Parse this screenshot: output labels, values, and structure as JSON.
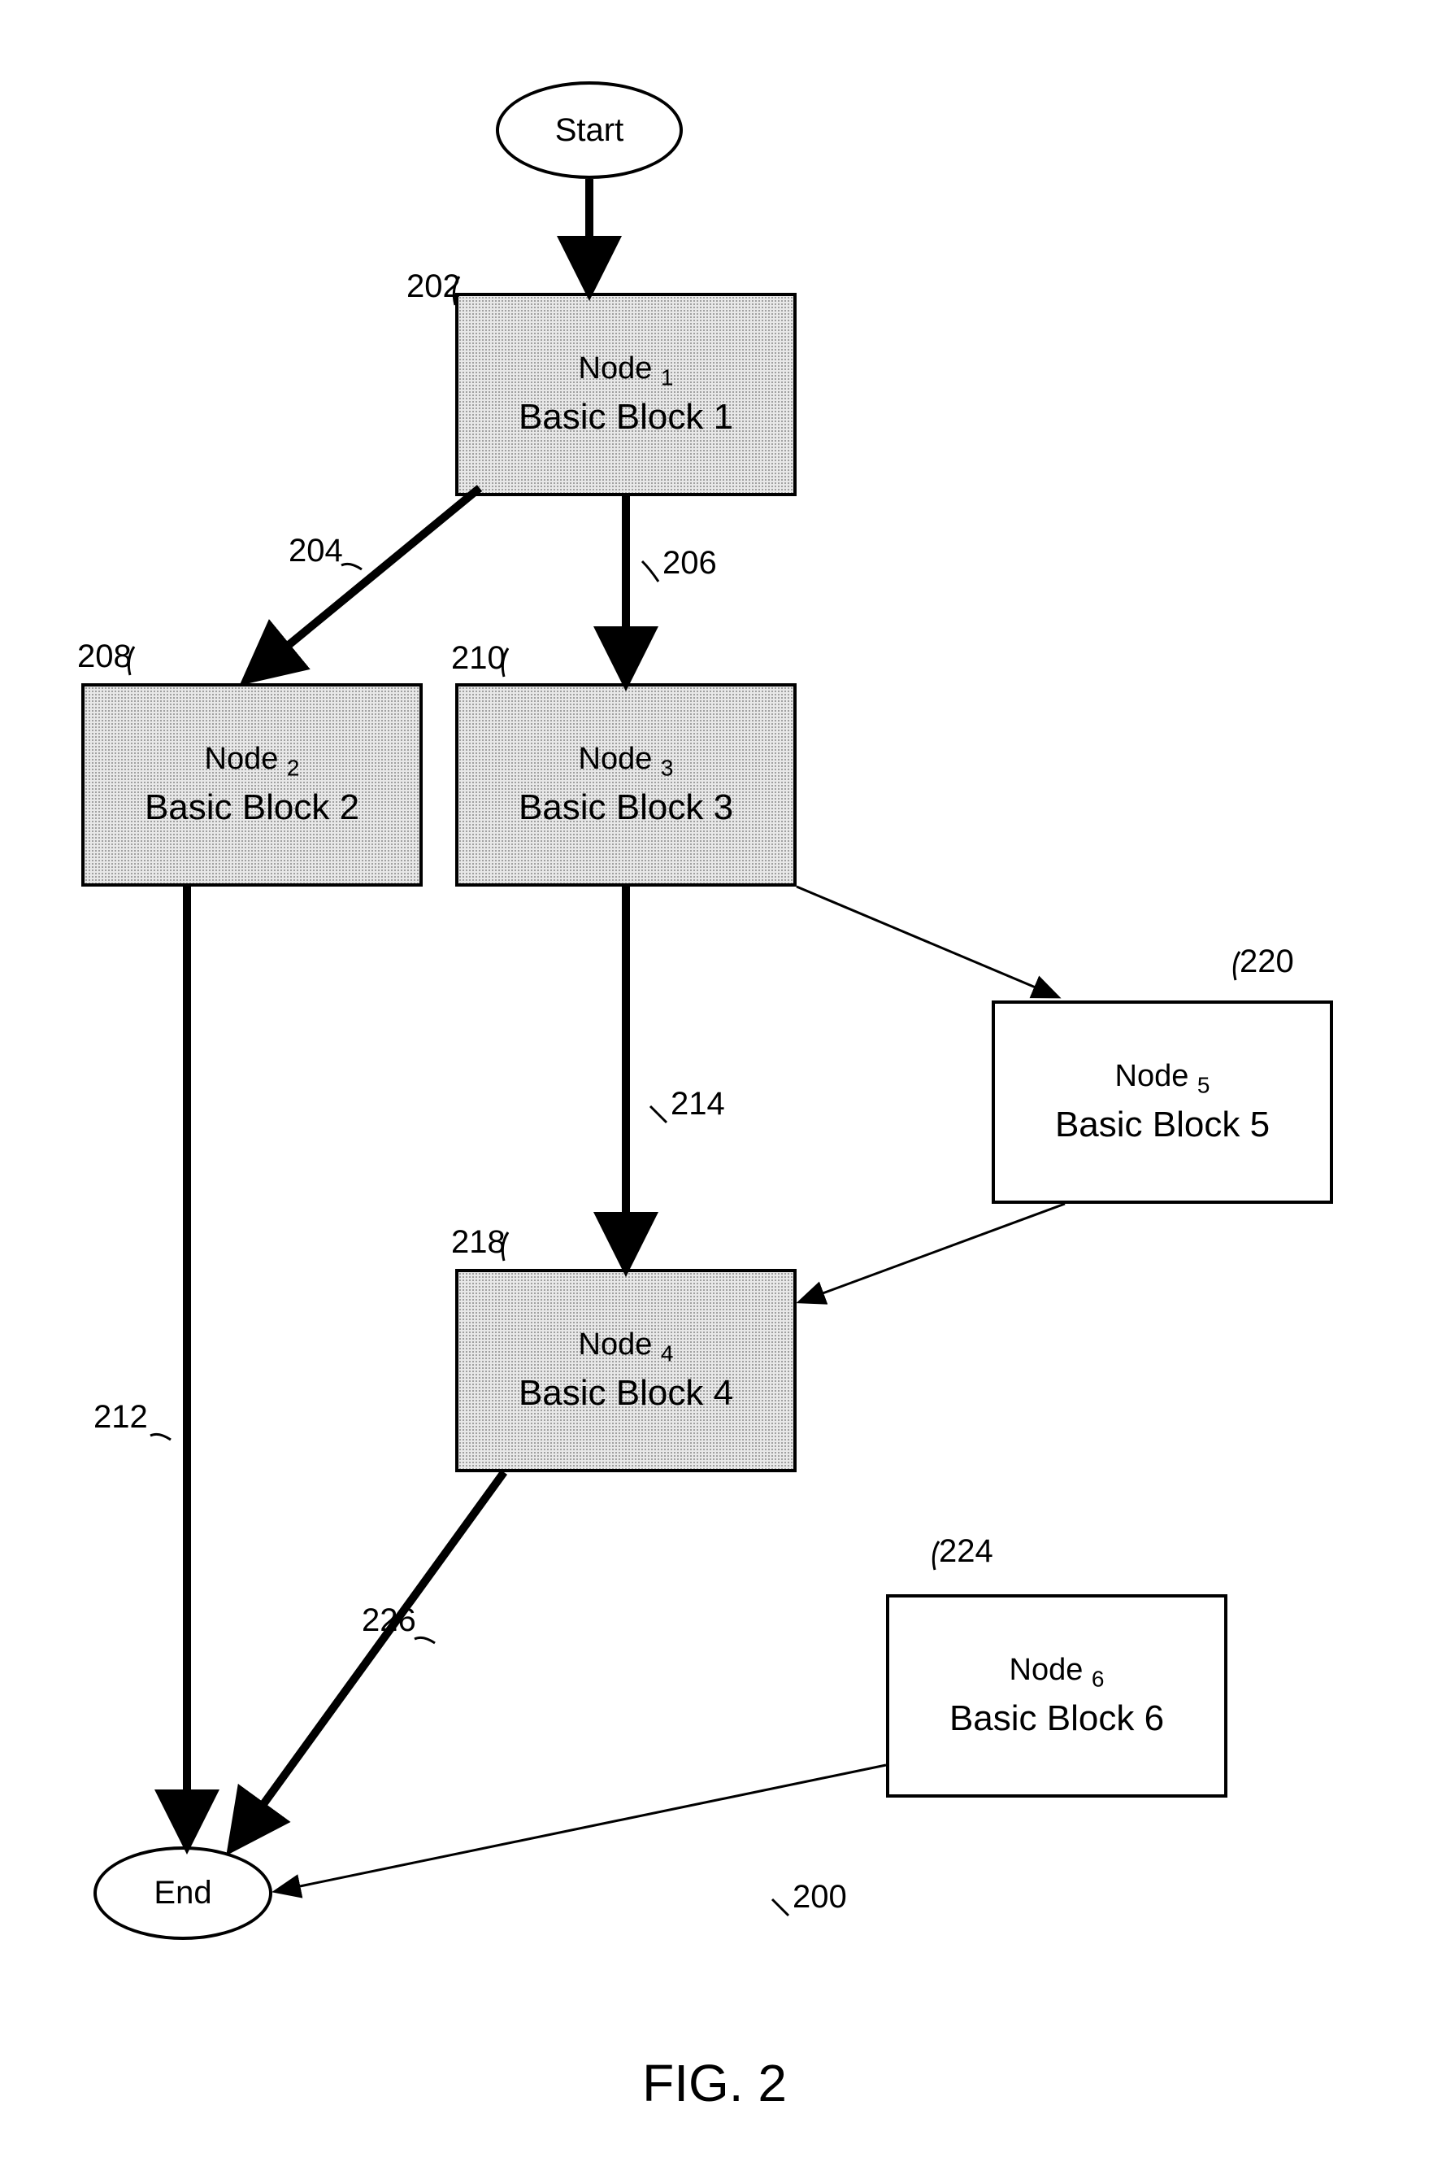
{
  "nodes": {
    "start": {
      "label": "Start"
    },
    "end": {
      "label": "End"
    },
    "n1": {
      "title": "Node ",
      "sub": "1",
      "subtitle": "Basic Block 1"
    },
    "n2": {
      "title": "Node ",
      "sub": "2",
      "subtitle": "Basic Block 2"
    },
    "n3": {
      "title": "Node ",
      "sub": "3",
      "subtitle": "Basic Block 3"
    },
    "n4": {
      "title": "Node ",
      "sub": "4",
      "subtitle": "Basic Block 4"
    },
    "n5": {
      "title": "Node ",
      "sub": "5",
      "subtitle": "Basic Block 5"
    },
    "n6": {
      "title": "Node ",
      "sub": "6",
      "subtitle": "Basic Block 6"
    }
  },
  "refs": {
    "r200": "200",
    "r202": "202",
    "r204": "204",
    "r206": "206",
    "r208": "208",
    "r210": "210",
    "r212": "212",
    "r214": "214",
    "r218": "218",
    "r220": "220",
    "r224": "224",
    "r226": "226"
  },
  "figure": "FIG. 2"
}
